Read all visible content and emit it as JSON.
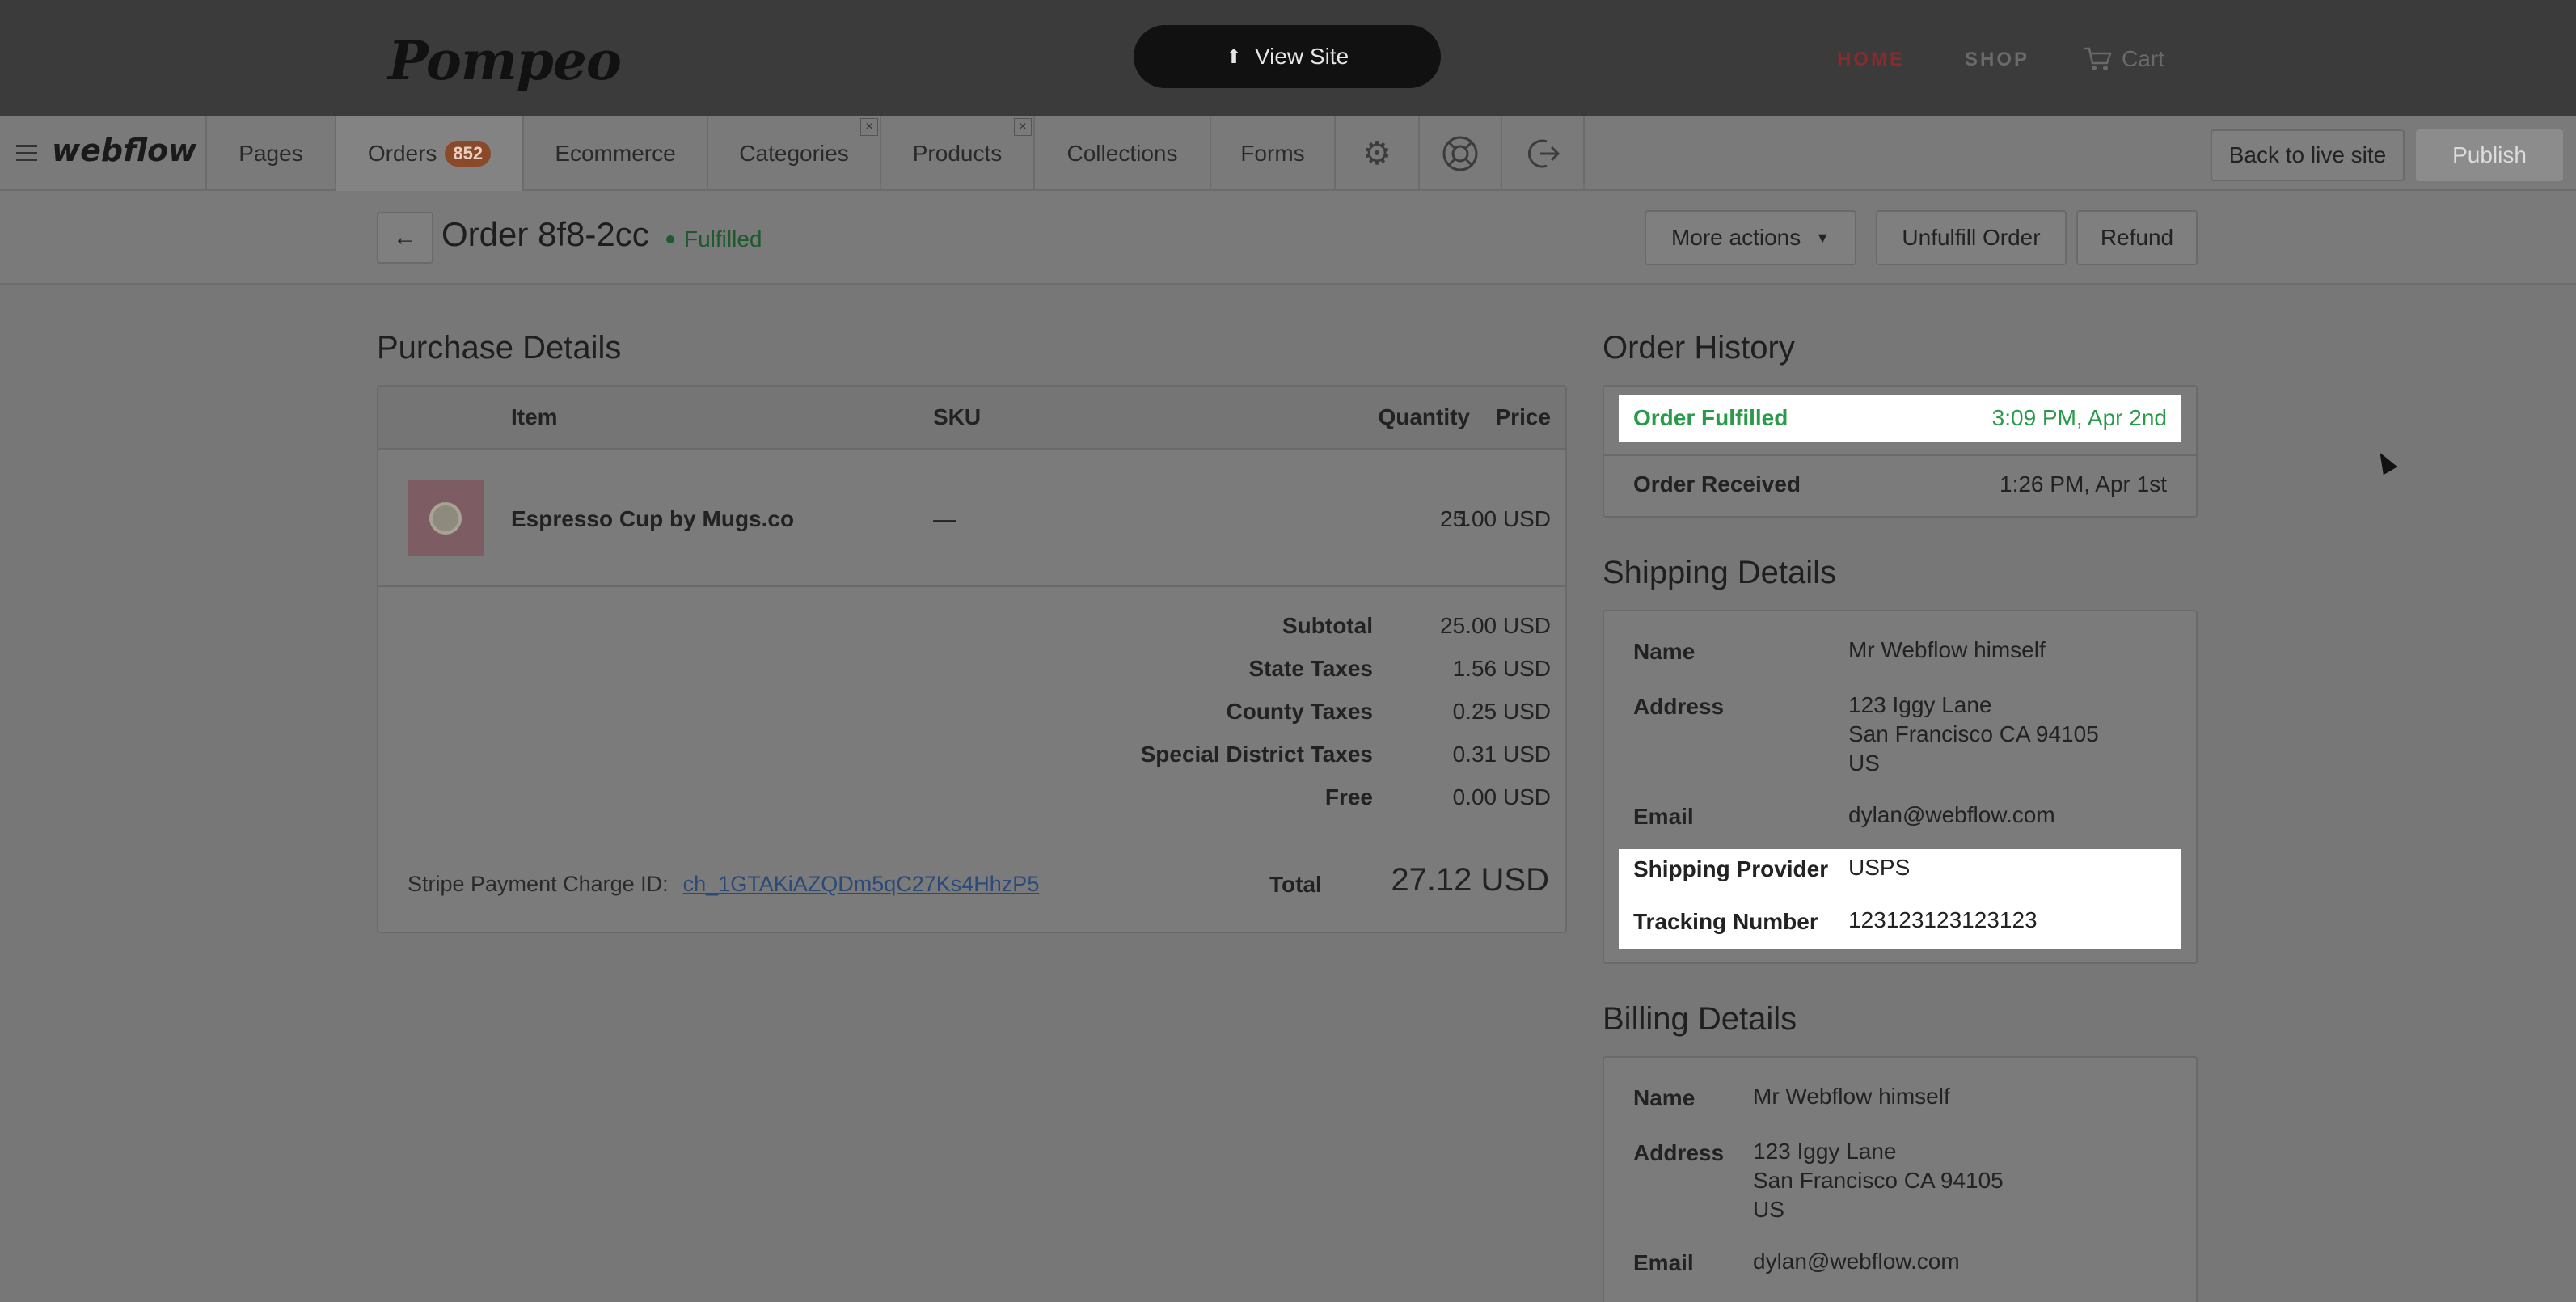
{
  "site": {
    "logo": "Pompeo",
    "view_site": "View Site",
    "nav": {
      "home": "HOME",
      "shop": "SHOP",
      "cart": "Cart"
    }
  },
  "toolbar": {
    "brand": "webflow",
    "tabs": {
      "pages": "Pages",
      "orders": "Orders",
      "orders_badge": "852",
      "ecommerce": "Ecommerce",
      "categories": "Categories",
      "products": "Products",
      "collections": "Collections",
      "forms": "Forms"
    },
    "back_to_live": "Back to live site",
    "publish": "Publish"
  },
  "order": {
    "title": "Order 8f8-2cc",
    "status": "Fulfilled",
    "more_actions": "More actions",
    "unfulfill": "Unfulfill Order",
    "refund": "Refund"
  },
  "purchase": {
    "heading": "Purchase Details",
    "columns": {
      "item": "Item",
      "sku": "SKU",
      "quantity": "Quantity",
      "price": "Price"
    },
    "item": {
      "name": "Espresso Cup by Mugs.co",
      "sku": "—",
      "quantity": "1",
      "price": "25.00 USD"
    },
    "totals": [
      {
        "label": "Subtotal",
        "value": "25.00 USD"
      },
      {
        "label": "State Taxes",
        "value": "1.56 USD"
      },
      {
        "label": "County Taxes",
        "value": "0.25 USD"
      },
      {
        "label": "Special District Taxes",
        "value": "0.31 USD"
      },
      {
        "label": "Free",
        "value": "0.00 USD"
      }
    ],
    "stripe_label": "Stripe Payment Charge ID:",
    "stripe_id": "ch_1GTAKiAZQDm5qC27Ks4HhzP5",
    "total_label": "Total",
    "total_value": "27.12 USD"
  },
  "history": {
    "heading": "Order History",
    "events": [
      {
        "label": "Order Fulfilled",
        "time": "3:09 PM, Apr 2nd"
      },
      {
        "label": "Order Received",
        "time": "1:26 PM, Apr 1st"
      }
    ]
  },
  "shipping": {
    "heading": "Shipping Details",
    "name_label": "Name",
    "name": "Mr Webflow himself",
    "address_label": "Address",
    "address_line1": "123 Iggy Lane",
    "address_line2": "San Francisco CA 94105",
    "address_line3": "US",
    "email_label": "Email",
    "email": "dylan@webflow.com",
    "provider_label": "Shipping Provider",
    "provider": "USPS",
    "tracking_label": "Tracking Number",
    "tracking": "123123123123123"
  },
  "billing": {
    "heading": "Billing Details",
    "name_label": "Name",
    "name": "Mr Webflow himself",
    "address_label": "Address",
    "address_line1": "123 Iggy Lane",
    "address_line2": "San Francisco CA 94105",
    "address_line3": "US",
    "email_label": "Email",
    "email": "dylan@webflow.com"
  }
}
